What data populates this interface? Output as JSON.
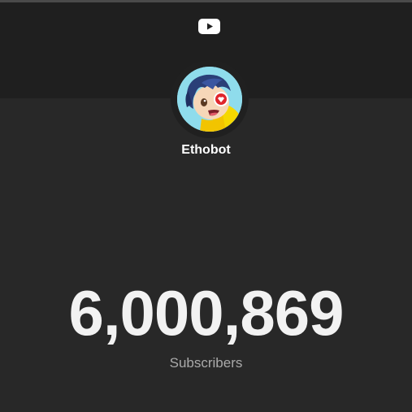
{
  "channel": {
    "name": "Ethobot"
  },
  "subscribers": {
    "count": "6,000,869",
    "label": "Subscribers"
  },
  "icons": {
    "logo": "youtube-play-icon"
  },
  "colors": {
    "background": "#282828",
    "header_band": "#1f1f1f",
    "count_text": "#f2f2f2",
    "label_text": "#aaaaaa"
  }
}
